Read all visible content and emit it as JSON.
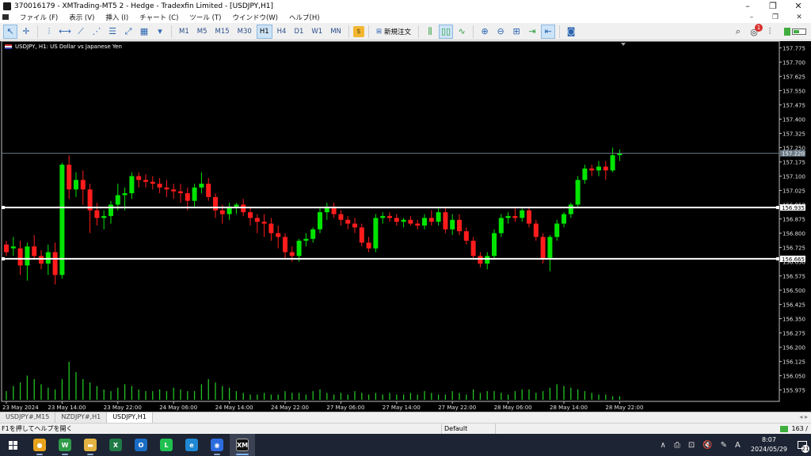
{
  "window": {
    "title": "370016179 - XMTrading-MT5 2 - Hedge - Tradexfin Limited - [USDJPY,H1]"
  },
  "menu": [
    "ファイル (F)",
    "表示 (V)",
    "挿入 (I)",
    "チャート (C)",
    "ツール (T)",
    "ウインドウ(W)",
    "ヘルプ(H)"
  ],
  "toolbar": {
    "timeframes": [
      "M1",
      "M5",
      "M15",
      "M30",
      "H1",
      "H4",
      "D1",
      "W1",
      "MN"
    ],
    "active_timeframe": "H1",
    "new_order_label": "新規注文",
    "notification_count": "1"
  },
  "chart": {
    "symbol_label": "USDJPY, H1:  US Dollar vs Japanese Yen",
    "current_price": "157.220",
    "levels": [
      {
        "label": "156.935",
        "price": 156.935,
        "color": "#ffffff"
      },
      {
        "label": "156.665",
        "price": 156.665,
        "color": "#ffffff"
      }
    ],
    "bull_color": "#00e400",
    "bear_color": "#ff1c1c"
  },
  "chart_data": {
    "type": "candlestick",
    "symbol": "USDJPY",
    "timeframe": "H1",
    "price_axis": {
      "ylim": [
        155.915,
        157.81
      ],
      "ticks": [
        "157.775",
        "157.700",
        "157.625",
        "157.550",
        "157.475",
        "157.400",
        "157.325",
        "157.250",
        "157.175",
        "157.100",
        "157.025",
        "156.950",
        "156.875",
        "156.800",
        "156.725",
        "156.650",
        "156.575",
        "156.500",
        "156.425",
        "156.350",
        "156.275",
        "156.200",
        "156.125",
        "156.050",
        "155.975"
      ]
    },
    "time_axis": {
      "ticks": [
        "23 May 2024",
        "23 May 14:00",
        "23 May 22:00",
        "24 May 06:00",
        "24 May 14:00",
        "24 May 22:00",
        "27 May 06:00",
        "27 May 14:00",
        "27 May 22:00",
        "28 May 06:00",
        "28 May 14:00",
        "28 May 22:00"
      ]
    },
    "ohlc": [
      [
        156.74,
        156.76,
        156.68,
        156.7
      ],
      [
        156.72,
        156.78,
        156.68,
        156.73
      ],
      [
        156.72,
        156.76,
        156.58,
        156.63
      ],
      [
        156.63,
        156.75,
        156.55,
        156.73
      ],
      [
        156.73,
        156.79,
        156.66,
        156.68
      ],
      [
        156.68,
        156.71,
        156.61,
        156.64
      ],
      [
        156.64,
        156.74,
        156.58,
        156.7
      ],
      [
        156.7,
        156.75,
        156.53,
        156.58
      ],
      [
        156.58,
        157.17,
        156.56,
        157.16
      ],
      [
        157.16,
        157.21,
        156.98,
        157.03
      ],
      [
        157.03,
        157.12,
        156.99,
        157.08
      ],
      [
        157.08,
        157.13,
        156.95,
        157.03
      ],
      [
        157.03,
        157.06,
        156.8,
        156.92
      ],
      [
        156.92,
        156.96,
        156.84,
        156.88
      ],
      [
        156.88,
        156.92,
        156.82,
        156.89
      ],
      [
        156.89,
        156.97,
        156.85,
        156.95
      ],
      [
        156.95,
        157.06,
        156.92,
        157.0
      ],
      [
        157.0,
        157.04,
        156.92,
        157.01
      ],
      [
        157.01,
        157.12,
        156.98,
        157.1
      ],
      [
        157.1,
        157.12,
        157.04,
        157.08
      ],
      [
        157.08,
        157.11,
        157.04,
        157.07
      ],
      [
        157.07,
        157.1,
        157.03,
        157.06
      ],
      [
        157.06,
        157.09,
        157.01,
        157.04
      ],
      [
        157.04,
        157.08,
        156.99,
        157.03
      ],
      [
        157.03,
        157.06,
        156.98,
        157.02
      ],
      [
        157.02,
        157.06,
        156.96,
        157.01
      ],
      [
        157.01,
        157.04,
        156.92,
        156.97
      ],
      [
        156.97,
        157.06,
        156.94,
        157.04
      ],
      [
        157.04,
        157.12,
        157.01,
        157.06
      ],
      [
        157.06,
        157.09,
        156.97,
        156.99
      ],
      [
        156.99,
        157.01,
        156.88,
        156.92
      ],
      [
        156.92,
        156.95,
        156.85,
        156.9
      ],
      [
        156.9,
        156.96,
        156.87,
        156.94
      ],
      [
        156.94,
        156.96,
        156.9,
        156.95
      ],
      [
        156.95,
        156.98,
        156.89,
        156.91
      ],
      [
        156.91,
        156.94,
        156.84,
        156.88
      ],
      [
        156.88,
        156.9,
        156.8,
        156.86
      ],
      [
        156.86,
        156.9,
        156.78,
        156.85
      ],
      [
        156.85,
        156.88,
        156.76,
        156.8
      ],
      [
        156.8,
        156.84,
        156.72,
        156.78
      ],
      [
        156.78,
        156.8,
        156.66,
        156.7
      ],
      [
        156.7,
        156.73,
        156.65,
        156.68
      ],
      [
        156.68,
        156.77,
        156.65,
        156.76
      ],
      [
        156.76,
        156.8,
        156.73,
        156.77
      ],
      [
        156.77,
        156.83,
        156.75,
        156.82
      ],
      [
        156.82,
        156.93,
        156.8,
        156.91
      ],
      [
        156.91,
        156.96,
        156.87,
        156.94
      ],
      [
        156.94,
        156.96,
        156.88,
        156.9
      ],
      [
        156.9,
        156.92,
        156.84,
        156.87
      ],
      [
        156.87,
        156.89,
        156.82,
        156.85
      ],
      [
        156.85,
        156.88,
        156.8,
        156.83
      ],
      [
        156.83,
        156.85,
        156.73,
        156.75
      ],
      [
        156.75,
        156.78,
        156.7,
        156.72
      ],
      [
        156.72,
        156.9,
        156.7,
        156.88
      ],
      [
        156.88,
        156.91,
        156.85,
        156.89
      ],
      [
        156.89,
        156.91,
        156.86,
        156.88
      ],
      [
        156.88,
        156.9,
        156.84,
        156.86
      ],
      [
        156.86,
        156.88,
        156.83,
        156.87
      ],
      [
        156.87,
        156.89,
        156.84,
        156.85
      ],
      [
        156.85,
        156.87,
        156.82,
        156.84
      ],
      [
        156.84,
        156.9,
        156.82,
        156.88
      ],
      [
        156.88,
        156.92,
        156.84,
        156.86
      ],
      [
        156.86,
        156.93,
        156.84,
        156.91
      ],
      [
        156.91,
        156.93,
        156.8,
        156.82
      ],
      [
        156.82,
        156.9,
        156.79,
        156.87
      ],
      [
        156.87,
        156.9,
        156.79,
        156.81
      ],
      [
        156.81,
        156.83,
        156.74,
        156.76
      ],
      [
        156.76,
        156.78,
        156.66,
        156.68
      ],
      [
        156.68,
        156.7,
        156.62,
        156.64
      ],
      [
        156.64,
        156.7,
        156.61,
        156.68
      ],
      [
        156.68,
        156.82,
        156.66,
        156.8
      ],
      [
        156.8,
        156.9,
        156.78,
        156.88
      ],
      [
        156.88,
        156.91,
        156.85,
        156.89
      ],
      [
        156.89,
        156.93,
        156.86,
        156.88
      ],
      [
        156.88,
        156.93,
        156.86,
        156.92
      ],
      [
        156.92,
        156.94,
        156.83,
        156.85
      ],
      [
        156.85,
        156.87,
        156.76,
        156.78
      ],
      [
        156.78,
        156.8,
        156.64,
        156.67
      ],
      [
        156.67,
        156.79,
        156.6,
        156.78
      ],
      [
        156.78,
        156.87,
        156.76,
        156.85
      ],
      [
        156.85,
        156.91,
        156.83,
        156.9
      ],
      [
        156.9,
        156.96,
        156.88,
        156.95
      ],
      [
        156.95,
        157.1,
        156.94,
        157.08
      ],
      [
        157.08,
        157.16,
        157.06,
        157.14
      ],
      [
        157.14,
        157.16,
        157.1,
        157.13
      ],
      [
        157.13,
        157.18,
        157.1,
        157.15
      ],
      [
        157.15,
        157.18,
        157.08,
        157.13
      ],
      [
        157.13,
        157.25,
        157.12,
        157.21
      ],
      [
        157.21,
        157.24,
        157.18,
        157.22
      ]
    ],
    "volume": [
      5,
      8,
      10,
      14,
      12,
      9,
      7,
      6,
      12,
      22,
      16,
      12,
      10,
      8,
      6,
      5,
      7,
      9,
      8,
      6,
      5,
      5,
      6,
      5,
      7,
      6,
      5,
      5,
      9,
      12,
      10,
      8,
      7,
      5,
      4,
      3,
      3,
      4,
      3,
      3,
      5,
      4,
      4,
      3,
      5,
      6,
      4,
      3,
      4,
      3,
      5,
      4,
      3,
      4,
      3,
      4,
      3,
      3,
      4,
      3,
      5,
      4,
      3,
      3,
      5,
      4,
      3,
      6,
      4,
      5,
      5,
      4,
      3,
      5,
      6,
      6,
      4,
      5,
      7,
      9,
      8,
      7,
      6,
      5,
      4,
      3,
      3,
      2,
      2
    ]
  },
  "tabs": [
    "USDJPY#,M15",
    "NZDJPY#,H1",
    "USDJPY,H1"
  ],
  "active_tab": "USDJPY,H1",
  "status": {
    "help": "F1を押してヘルプを開く",
    "profile": "Default",
    "ping": "163 /"
  },
  "taskbar": {
    "apps": [
      {
        "name": "chrome",
        "color": "#e8a21c",
        "glyph": "●",
        "open": true
      },
      {
        "name": "word-style",
        "color": "#2f9b48",
        "glyph": "W",
        "open": true
      },
      {
        "name": "explorer",
        "color": "#e3b341",
        "glyph": "▬",
        "open": true
      },
      {
        "name": "excel",
        "color": "#1f7a45",
        "glyph": "X",
        "open": false
      },
      {
        "name": "outlook",
        "color": "#1a6cc4",
        "glyph": "O",
        "open": false
      },
      {
        "name": "line",
        "color": "#1fbf50",
        "glyph": "L",
        "open": false
      },
      {
        "name": "edge",
        "color": "#1e88d4",
        "glyph": "e",
        "open": false
      },
      {
        "name": "zoom",
        "color": "#2d6cdf",
        "glyph": "◉",
        "open": true
      },
      {
        "name": "xm",
        "color": "#111111",
        "glyph": "XM",
        "open": true
      }
    ],
    "time": "8:07",
    "date": "2024/05/29",
    "ime": "A",
    "notifications": "21"
  }
}
